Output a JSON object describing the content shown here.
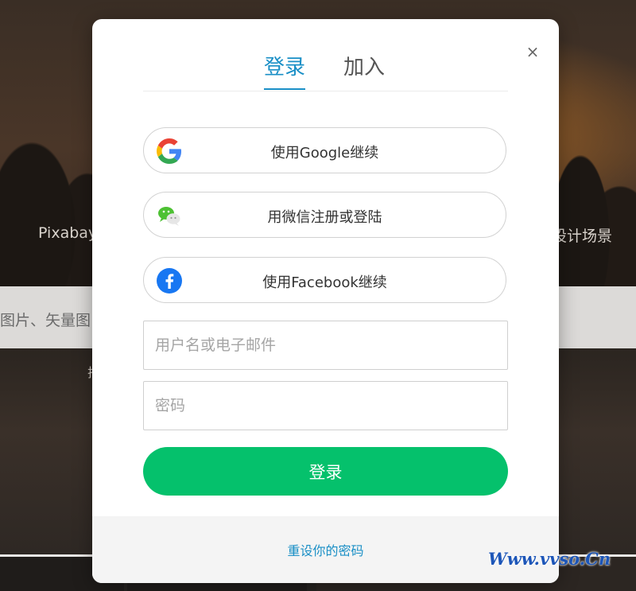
{
  "background": {
    "headline_left": "Pixabay",
    "headline_right": "设计场景",
    "search_placeholder": "图片、矢量图",
    "nav_fragment": "排"
  },
  "modal": {
    "tabs": [
      {
        "label": "登录",
        "active": true
      },
      {
        "label": "加入",
        "active": false
      }
    ],
    "close_icon": "×",
    "sso": {
      "google": {
        "label": "使用Google继续",
        "icon": "google-icon"
      },
      "wechat": {
        "label": "用微信注册或登陆",
        "icon": "wechat-icon"
      },
      "facebook": {
        "label": "使用Facebook继续",
        "icon": "facebook-icon"
      }
    },
    "username_placeholder": "用户名或电子邮件",
    "password_placeholder": "密码",
    "submit_label": "登录",
    "reset_link": "重设你的密码"
  },
  "watermark": "Www.vvso.Cn",
  "colors": {
    "accent": "#1a8fc6",
    "submit": "#05c16c",
    "facebook": "#1877f2",
    "wechat": "#4dc133"
  }
}
